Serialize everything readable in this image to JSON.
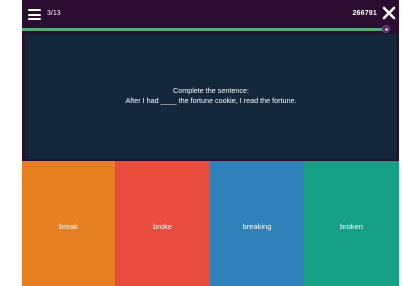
{
  "header": {
    "counter": "3/13",
    "code": "266791"
  },
  "progress": {
    "value": 0.23
  },
  "question": {
    "line1": "Complete the sentence:",
    "line2": "After I had ____ the fortune cookie, I read the fortune."
  },
  "answers": [
    {
      "label": "break",
      "color": "#e67e22"
    },
    {
      "label": "broke",
      "color": "#e74c3c"
    },
    {
      "label": "breaking",
      "color": "#2e80b8"
    },
    {
      "label": "broken",
      "color": "#16a085"
    }
  ],
  "colors": {
    "background": "#2b0d31",
    "question_panel": "#15273b",
    "progress": "#5ba87a"
  },
  "icons": {
    "menu": "hamburger-menu-icon",
    "close": "close-icon"
  }
}
